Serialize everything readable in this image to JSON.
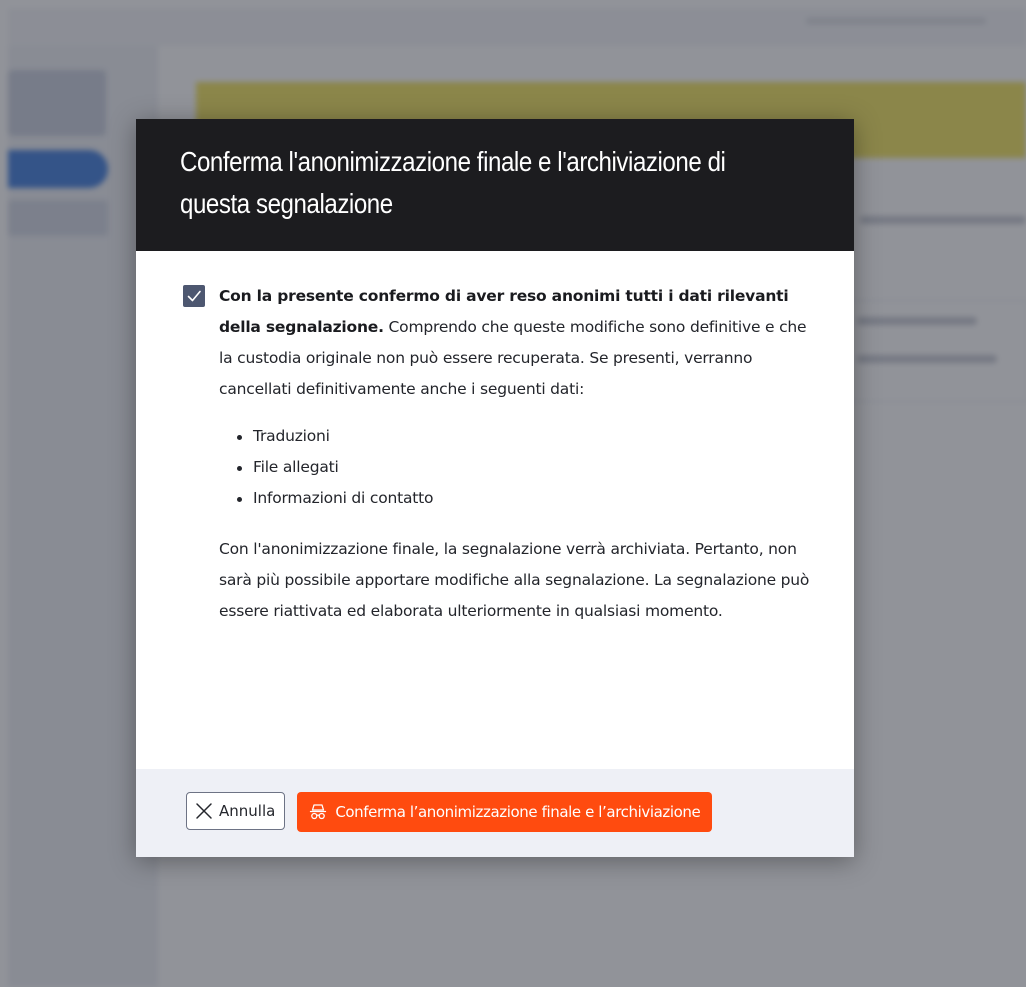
{
  "modal": {
    "title": "Conferma l'anonimizzazione finale e l'archiviazione di questa segnalazione",
    "checkbox_checked": true,
    "confirm_bold": "Con la presente confermo di aver reso anonimi tutti i dati rilevanti della segnalazione.",
    "confirm_rest": " Comprendo che queste modifiche sono definitive e che la custodia originale non può essere recuperata. Se presenti, verranno cancellati definitivamente anche i seguenti dati:",
    "deleted_items": [
      "Traduzioni",
      "File allegati",
      "Informazioni di contatto"
    ],
    "info": "Con l'anonimizzazione finale, la segnalazione verrà archiviata. Pertanto, non sarà più possibile apportare modifiche alla segnalazione. La segnalazione può essere riattivata ed elaborata ulteriormente in qualsiasi momento.",
    "cancel_label": "Annulla",
    "cancel_icon": "close-icon",
    "confirm_label": "Conferma l’anonimizzazione finale e l’archiviazione",
    "confirm_icon": "anonymous-incognito-icon"
  },
  "colors": {
    "header_bg": "#1c1c1f",
    "accent": "#ff4b0f",
    "checkbox": "#4d5770",
    "footer_bg": "#eef0f6"
  }
}
